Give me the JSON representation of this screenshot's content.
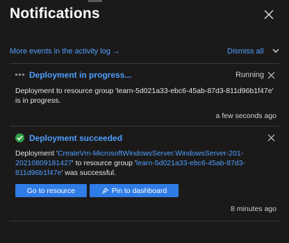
{
  "panel": {
    "title": "Notifications",
    "activity_link": "More events in the activity log",
    "activity_arrow": "→",
    "dismiss_all": "Dismiss all"
  },
  "notifications": [
    {
      "title": "Deployment in progress...",
      "status": "Running",
      "body_prefix": "Deployment to resource group 'learn-5d021a33-ebc6-45ab-87d3-811d96b1f47e' is in progress.",
      "time": "a few seconds ago"
    },
    {
      "title": "Deployment succeeded",
      "body_part1": "Deployment '",
      "deployment_link_line1": "CreateVm-MicrosoftWindowsServer.WindowsServer-201-",
      "deployment_link_line2": "20210809181427",
      "body_part2": "' to resource group '",
      "rg_link_line1": "learn-5d021a33-ebc6-45ab-87d3-",
      "rg_link_line2": "811d96b1f47e",
      "body_part3": "' was successful.",
      "button_go": "Go to resource",
      "button_pin": "Pin to dashboard",
      "time": "8 minutes ago"
    }
  ]
}
